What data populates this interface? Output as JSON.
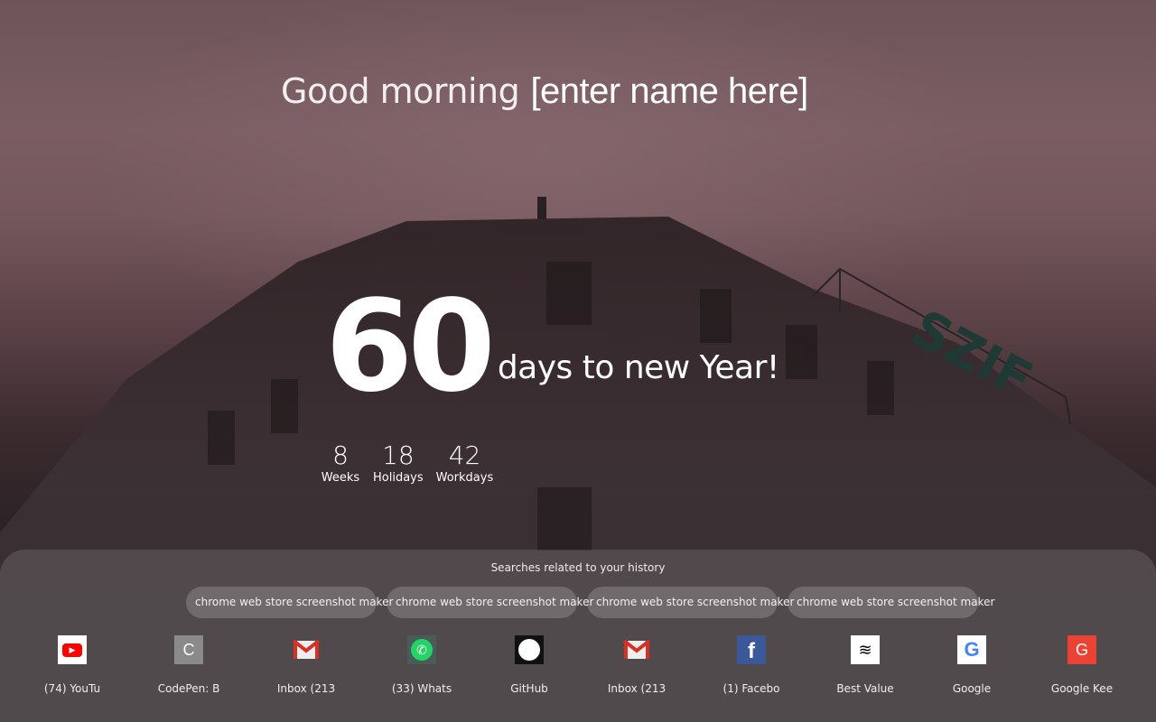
{
  "greeting": {
    "prefix": "Good morning",
    "name": "[enter name here]"
  },
  "countdown": {
    "days": "60",
    "suffix": "days to new Year!"
  },
  "stats": [
    {
      "value": "8",
      "label": "Weeks"
    },
    {
      "value": "18",
      "label": "Holidays"
    },
    {
      "value": "42",
      "label": "Workdays"
    }
  ],
  "searches": {
    "title": "Searches related to your history",
    "items": [
      "chrome web store screenshot maker",
      "chrome web store screenshot maker",
      "chrome web store screenshot maker",
      "chrome web store screenshot maker"
    ]
  },
  "shortcuts": [
    {
      "label": "(74) YouTu",
      "icon": "youtube-icon",
      "glyph": "▶",
      "bg": "#ffffff",
      "fg": "#ff0000"
    },
    {
      "label": "CodePen: B",
      "icon": "codepen-letter-icon",
      "glyph": "C",
      "bg": "#8a8a8a",
      "fg": "#ffffff"
    },
    {
      "label": "Inbox (213",
      "icon": "gmail-icon",
      "glyph": "M",
      "bg": "transparent",
      "fg": "#d93025"
    },
    {
      "label": "(33) Whats",
      "icon": "whatsapp-icon",
      "glyph": "✆",
      "bg": "#4a5c5a",
      "fg": "#25d366"
    },
    {
      "label": "GitHub",
      "icon": "github-icon",
      "glyph": "●",
      "bg": "#111111",
      "fg": "#ffffff"
    },
    {
      "label": "Inbox (213",
      "icon": "gmail-icon",
      "glyph": "M",
      "bg": "transparent",
      "fg": "#d93025"
    },
    {
      "label": "(1) Facebo",
      "icon": "facebook-icon",
      "glyph": "f",
      "bg": "#3b5998",
      "fg": "#ffffff"
    },
    {
      "label": "Best Value",
      "icon": "sprint-icon",
      "glyph": "≋",
      "bg": "#ffffff",
      "fg": "#000000"
    },
    {
      "label": "Google",
      "icon": "google-icon",
      "glyph": "G",
      "bg": "#ffffff",
      "fg": "#4285f4"
    },
    {
      "label": "Google Kee",
      "icon": "google-keep-letter-icon",
      "glyph": "G",
      "bg": "#ea4335",
      "fg": "#ffffff"
    }
  ]
}
